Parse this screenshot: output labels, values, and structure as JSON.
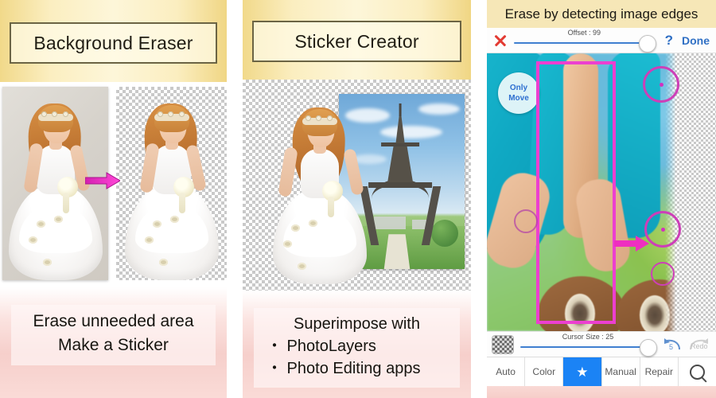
{
  "panels": [
    {
      "id": "background-eraser",
      "title": "Background Eraser",
      "caption_lines": [
        "Erase unneeded area",
        "Make a Sticker"
      ],
      "arrow_color": "#ee2fc0",
      "before_label": "original photo with gray background",
      "after_label": "photo with transparent checkerboard background"
    },
    {
      "id": "sticker-creator",
      "title": "Sticker Creator",
      "caption_lines": [
        "Superimpose with",
        "・ PhotoLayers",
        "・ Photo Editing apps"
      ],
      "scene_label": "bride composited over Eiffel Tower photo"
    },
    {
      "id": "app-screen",
      "header": "Erase by detecting image edges",
      "toolbar": {
        "close_icon": "close-x-icon",
        "slider_label": "Offset : 99",
        "slider_value": 99,
        "slider_max": 100,
        "help_label": "?",
        "done_label": "Done"
      },
      "canvas": {
        "badge_line1": "Only",
        "badge_line2": "Move",
        "selection_rect_color": "#ec3fd0",
        "cursor_ring_color": "#cd3fb8",
        "arrow_color": "#ee2fc0"
      },
      "cursor_bar": {
        "swatch_label": "transparency-swatch",
        "slider_label": "Cursor Size : 25",
        "slider_value": 25,
        "slider_max": 25,
        "undo_label": "5",
        "redo_label": "Redo"
      },
      "tabs": [
        {
          "label": "Auto",
          "active": false,
          "icon": null
        },
        {
          "label": "Color",
          "active": false,
          "icon": null
        },
        {
          "label": "",
          "active": true,
          "icon": "star-icon"
        },
        {
          "label": "Manual",
          "active": false,
          "icon": null
        },
        {
          "label": "Repair",
          "active": false,
          "icon": null
        },
        {
          "label": "",
          "active": false,
          "icon": "magnifier-icon"
        }
      ]
    }
  ],
  "colors": {
    "header_yellow": "#f6e7b7",
    "caption_pink": "#f6cfcb",
    "accent_blue": "#1b83f5",
    "link_blue": "#2f6fc4",
    "magenta": "#ee2fc0",
    "close_red": "#e33b33"
  }
}
